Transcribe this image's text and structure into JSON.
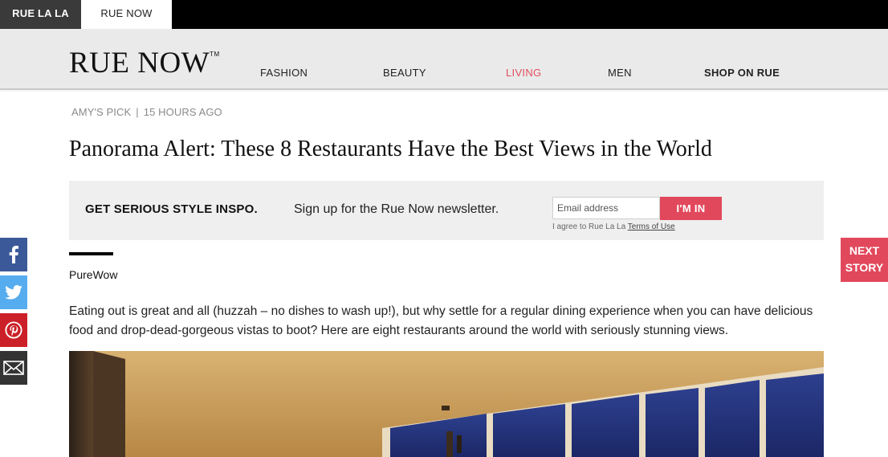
{
  "topbar": {
    "tab1": "RUE LA LA",
    "tab2": "RUE NOW"
  },
  "header": {
    "logo": "RUE NOW",
    "logo_tm": "TM",
    "nav": [
      "FASHION",
      "BEAUTY",
      "LIVING",
      "MEN",
      "SHOP ON RUE"
    ],
    "active_nav": "LIVING"
  },
  "article": {
    "author": "AMY'S PICK",
    "meta_sep": "|",
    "time": "15 HOURS AGO",
    "title": "Panorama Alert: These 8 Restaurants Have the Best Views in the World",
    "source": "PureWow",
    "body": "Eating out is great and all (huzzah – no dishes to wash up!), but why settle for a regular dining experience when you can have delicious food and drop-dead-gorgeous vistas to boot? Here are eight restaurants around the world with seriously stunning views."
  },
  "newsletter": {
    "heading": "GET SERIOUS STYLE INSPO.",
    "text": "Sign up for the Rue Now newsletter.",
    "placeholder": "Email address",
    "button": "I'M IN",
    "terms_prefix": "I agree to Rue La La ",
    "terms_link": "Terms of Use"
  },
  "side": {
    "next_line1": "NEXT",
    "next_line2": "STORY"
  },
  "icons": [
    "facebook-icon",
    "twitter-icon",
    "pinterest-icon",
    "email-icon"
  ],
  "colors": {
    "accent": "#e2485c",
    "facebook": "#3b5998",
    "twitter": "#55acee",
    "pinterest": "#cb2027"
  }
}
